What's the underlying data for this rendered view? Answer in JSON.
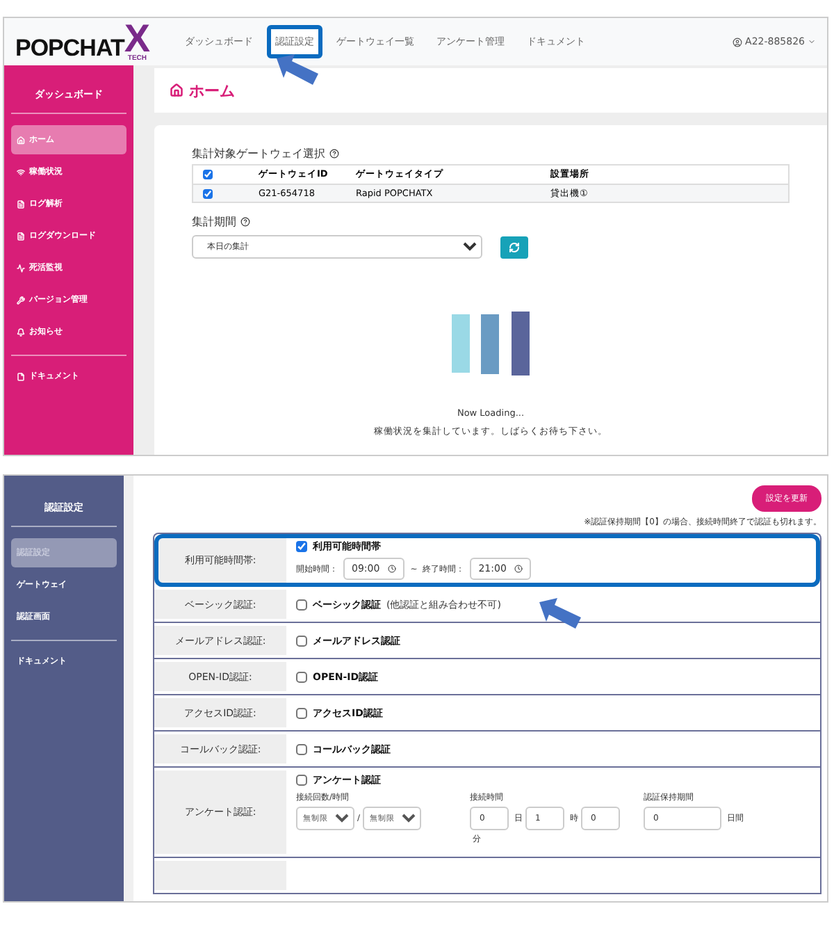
{
  "top": {
    "logo": "POPCHAT",
    "logo_mark": "X",
    "logo_sub": "TECH",
    "nav": [
      {
        "label": "ダッシュボード",
        "highlighted": false
      },
      {
        "label": "認証設定",
        "highlighted": true
      },
      {
        "label": "ゲートウェイ一覧",
        "highlighted": false
      },
      {
        "label": "アンケート管理",
        "highlighted": false
      },
      {
        "label": "ドキュメント",
        "highlighted": false
      }
    ],
    "user": "A22-885826",
    "sidebar": {
      "title": "ダッシュボード",
      "items": [
        {
          "label": "ホーム",
          "selected": true,
          "divider_before": false
        },
        {
          "label": "稼働状況",
          "selected": false,
          "divider_before": false
        },
        {
          "label": "ログ解析",
          "selected": false,
          "divider_before": false
        },
        {
          "label": "ログダウンロード",
          "selected": false,
          "divider_before": false
        },
        {
          "label": "死活監視",
          "selected": false,
          "divider_before": false
        },
        {
          "label": "バージョン管理",
          "selected": false,
          "divider_before": false
        },
        {
          "label": "お知らせ",
          "selected": false,
          "divider_before": false
        },
        {
          "label": "ドキュメント",
          "selected": false,
          "divider_before": true
        }
      ]
    },
    "page_title": "ホーム",
    "gateway_section": {
      "title": "集計対象ゲートウェイ選択",
      "header_checked": true,
      "columns": [
        "ゲートウェイID",
        "ゲートウェイタイプ",
        "設置場所"
      ],
      "rows": [
        {
          "checked": true,
          "cells": [
            "G21-654718",
            "Rapid POPCHATX",
            "貸出機①"
          ]
        }
      ]
    },
    "period": {
      "label": "集計期間",
      "value": "本日の集計"
    },
    "loading": {
      "text": "Now Loading...",
      "message": "稼働状況を集計しています。しばらくお待ち下さい。"
    }
  },
  "bottom": {
    "sidebar": {
      "title": "認証設定",
      "items": [
        {
          "label": "認証設定",
          "selected": true,
          "divider_before": false
        },
        {
          "label": "ゲートウェイ",
          "selected": false,
          "divider_before": false
        },
        {
          "label": "認証画面",
          "selected": false,
          "divider_before": false
        },
        {
          "label": "ドキュメント",
          "selected": false,
          "divider_before": true
        }
      ]
    },
    "update_button": "設定を更新",
    "note": "※認証保持期間【0】の場合、接続時間終了で認証も切れます。",
    "rows": [
      {
        "kind": "time",
        "label": "利用可能時間帯:",
        "highlighted": true,
        "checked": true,
        "check_label": "利用可能時間帯",
        "start_label": "開始時間：",
        "start": "09:00",
        "separator": "~",
        "end_label": "終了時間：",
        "end": "21:00"
      },
      {
        "kind": "check",
        "label": "ベーシック認証:",
        "highlighted": false,
        "checked": false,
        "check_label": "ベーシック認証",
        "note": "(他認証と組み合わせ不可)"
      },
      {
        "kind": "check",
        "label": "メールアドレス認証:",
        "highlighted": false,
        "checked": false,
        "check_label": "メールアドレス認証"
      },
      {
        "kind": "check",
        "label": "OPEN-ID認証:",
        "highlighted": false,
        "checked": false,
        "check_label": "OPEN-ID認証"
      },
      {
        "kind": "check",
        "label": "アクセスID認証:",
        "highlighted": false,
        "checked": false,
        "check_label": "アクセスID認証"
      },
      {
        "kind": "check",
        "label": "コールバック認証:",
        "highlighted": false,
        "checked": false,
        "check_label": "コールバック認証"
      },
      {
        "kind": "survey",
        "label": "アンケート認証:",
        "highlighted": false,
        "checked": false,
        "check_label": "アンケート認証",
        "count": {
          "label": "接続回数/時間",
          "selects": [
            "無制限",
            "無制限"
          ],
          "separator": "/"
        },
        "duration": {
          "label": "接続時間",
          "inputs": [
            {
              "value": "0",
              "unit": "日"
            },
            {
              "value": "1",
              "unit": "時"
            },
            {
              "value": "0",
              "unit": "分"
            }
          ]
        },
        "retention": {
          "label": "認証保持期間",
          "inputs": [
            {
              "value": "0",
              "unit": "日間"
            }
          ]
        }
      },
      {
        "kind": "blank",
        "highlighted": false
      }
    ]
  }
}
